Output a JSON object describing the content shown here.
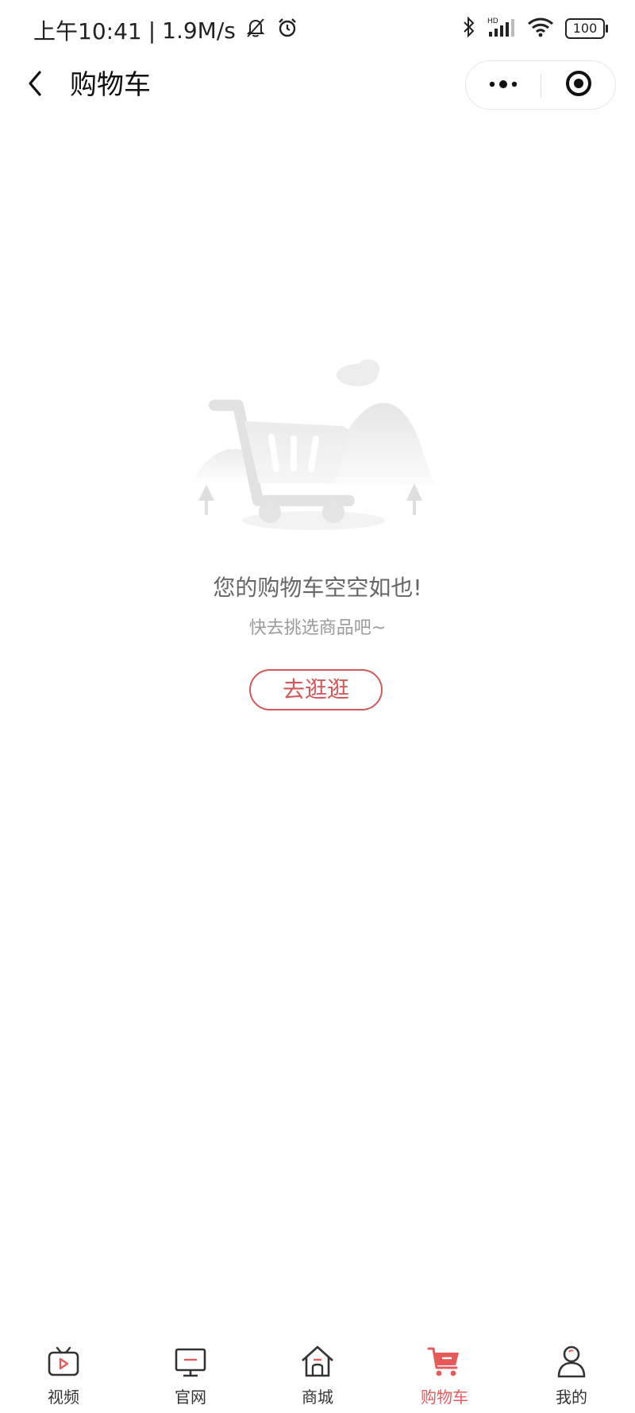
{
  "status_bar": {
    "time": "上午10:41",
    "separator": "|",
    "net_speed": "1.9M/s",
    "battery": "100",
    "icons": [
      "mute-bell-icon",
      "alarm-icon",
      "bluetooth-icon",
      "signal-hd-icon",
      "wifi-icon",
      "battery-icon"
    ]
  },
  "nav": {
    "title": "购物车",
    "back_icon": "chevron-left-icon",
    "more_icon": "more-dots-icon",
    "close_icon": "target-close-icon"
  },
  "empty_state": {
    "title": "您的购物车空空如也!",
    "subtitle": "快去挑选商品吧~",
    "button_label": "去逛逛",
    "illustration": "empty-cart-illustration"
  },
  "tab_bar": {
    "active_index": 3,
    "active_color": "#e85a5a",
    "items": [
      {
        "label": "视频",
        "icon": "tv-play-icon"
      },
      {
        "label": "官网",
        "icon": "monitor-icon"
      },
      {
        "label": "商城",
        "icon": "home-store-icon"
      },
      {
        "label": "购物车",
        "icon": "cart-icon"
      },
      {
        "label": "我的",
        "icon": "user-icon"
      }
    ]
  },
  "colors": {
    "accent": "#d35858",
    "background": "#ffffff",
    "title_text": "#666666",
    "subtitle_text": "#9a9a9a"
  }
}
